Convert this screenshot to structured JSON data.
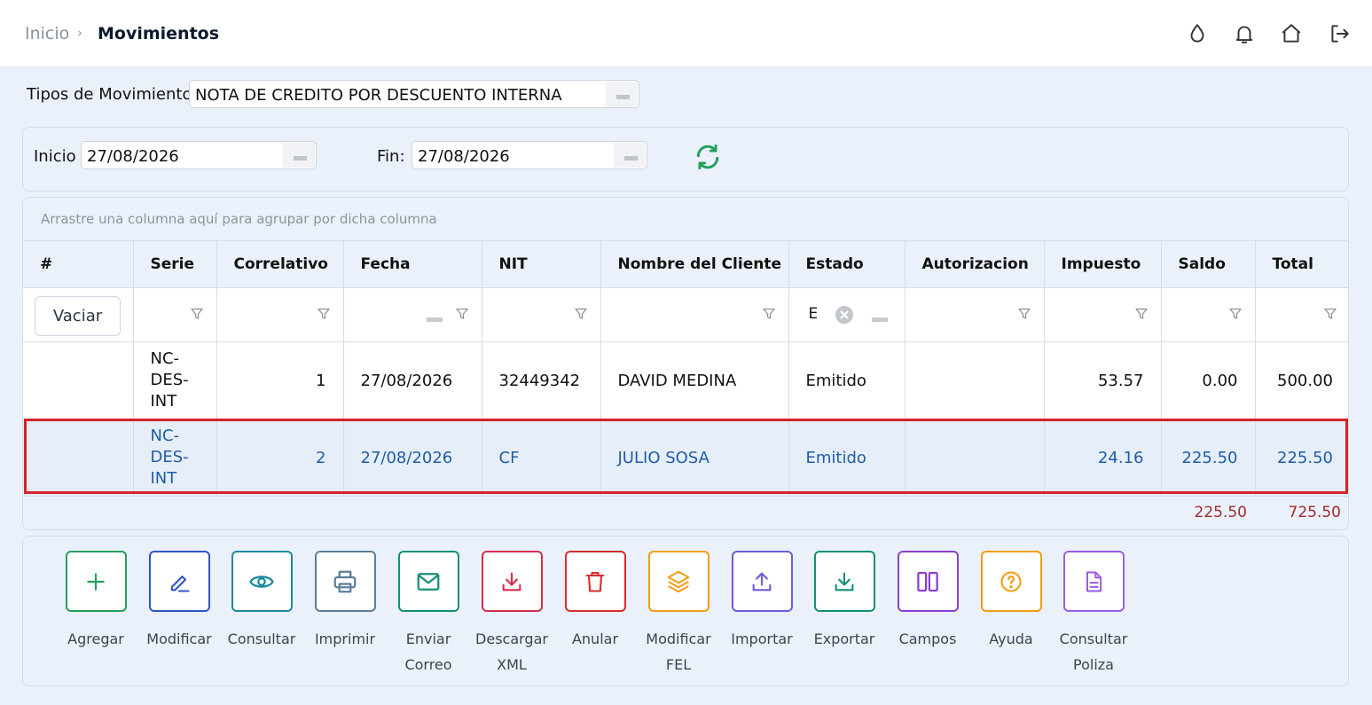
{
  "breadcrumb": {
    "home": "Inicio",
    "separator": "›",
    "current": "Movimientos"
  },
  "header_icons": [
    "theme-drop-icon",
    "bell-icon",
    "home-icon",
    "logout-icon"
  ],
  "tipo": {
    "label": "Tipos de Movimiento",
    "value": "NOTA DE CREDITO POR DESCUENTO INTERNA"
  },
  "dates": {
    "start_label": "Inicio",
    "start_value": "27/08/2026",
    "end_label": "Fin:",
    "end_value": "27/08/2026"
  },
  "grid": {
    "group_hint": "Arrastre una columna aquí para agrupar por dicha columna",
    "columns": [
      "#",
      "Serie",
      "Correlativo",
      "Fecha",
      "NIT",
      "Nombre del Cliente",
      "Estado",
      "Autorizacion",
      "Impuesto",
      "Saldo",
      "Total"
    ],
    "clear_button": "Vaciar",
    "estado_filter_value": "E",
    "rows": [
      {
        "serie": [
          "NC-",
          "DES-",
          "INT"
        ],
        "correlativo": "1",
        "fecha": "27/08/2026",
        "nit": "32449342",
        "cliente": "DAVID MEDINA",
        "estado": "Emitido",
        "autorizacion": "",
        "impuesto": "53.57",
        "saldo": "0.00",
        "total": "500.00",
        "selected": false
      },
      {
        "serie": [
          "NC-",
          "DES-",
          "INT"
        ],
        "correlativo": "2",
        "fecha": "27/08/2026",
        "nit": "CF",
        "cliente": "JULIO SOSA",
        "estado": "Emitido",
        "autorizacion": "",
        "impuesto": "24.16",
        "saldo": "225.50",
        "total": "225.50",
        "selected": true
      }
    ],
    "totals": {
      "saldo": "225.50",
      "total": "725.50"
    }
  },
  "actions": [
    {
      "label": [
        "Agregar"
      ],
      "icon": "plus-icon",
      "color": "#22a05a"
    },
    {
      "label": [
        "Modificar"
      ],
      "icon": "pencil-icon",
      "color": "#2f55c9"
    },
    {
      "label": [
        "Consultar"
      ],
      "icon": "eye-icon",
      "color": "#1c8aa0"
    },
    {
      "label": [
        "Imprimir"
      ],
      "icon": "printer-icon",
      "color": "#5b7e9b"
    },
    {
      "label": [
        "Enviar",
        "Correo"
      ],
      "icon": "mail-icon",
      "color": "#139076"
    },
    {
      "label": [
        "Descargar",
        "XML"
      ],
      "icon": "download-icon",
      "color": "#d72d4e"
    },
    {
      "label": [
        "Anular"
      ],
      "icon": "trash-icon",
      "color": "#d72d2d"
    },
    {
      "label": [
        "Modificar",
        "FEL"
      ],
      "icon": "layers-icon",
      "color": "#f39c12"
    },
    {
      "label": [
        "Importar"
      ],
      "icon": "upload-icon",
      "color": "#6d5bd6"
    },
    {
      "label": [
        "Exportar"
      ],
      "icon": "export-icon",
      "color": "#139076"
    },
    {
      "label": [
        "Campos"
      ],
      "icon": "columns-icon",
      "color": "#8a3fd1"
    },
    {
      "label": [
        "Ayuda"
      ],
      "icon": "help-icon",
      "color": "#f39c12"
    },
    {
      "label": [
        "Consultar",
        "Poliza"
      ],
      "icon": "document-icon",
      "color": "#9a5be0"
    }
  ],
  "colors": {
    "selected_outline": "#d6222a",
    "refresh": "#22a05a",
    "totals": "#a12b2b"
  }
}
